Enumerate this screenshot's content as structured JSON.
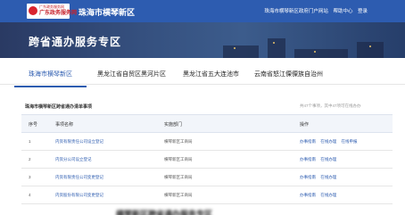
{
  "header": {
    "logo_line1": "广东政务服务网",
    "logo_line2": "广东政务服务网",
    "region": "珠海市横琴新区",
    "links": [
      "珠海市横琴新区政府门户网站",
      "帮助中心",
      "登录"
    ]
  },
  "banner": {
    "title": "跨省通办服务专区"
  },
  "tabs": [
    {
      "label": "珠海市横琴新区"
    },
    {
      "label": "黑龙江省自贸区黑河片区"
    },
    {
      "label": "黑龙江省五大连池市"
    },
    {
      "label": "云南省怒江傈僳族自治州"
    }
  ],
  "list": {
    "title": "珠海市横琴新区跨省通办清单事项",
    "count": "共47个事项，其中47项可在线办办",
    "headers": {
      "no": "序号",
      "name": "事项名称",
      "dept": "实施部门",
      "ops": "操作"
    },
    "rows": [
      {
        "no": "1",
        "name": "内资有限责任公司设立登记",
        "dept": "横琴新区工商局",
        "ops": [
          "办事指南",
          "在线办理",
          "在线申报"
        ]
      },
      {
        "no": "2",
        "name": "内资分公司设立登记",
        "dept": "横琴新区工商局",
        "ops": [
          "办事指南",
          "在线办理"
        ]
      },
      {
        "no": "3",
        "name": "内资有限责任公司变更登记",
        "dept": "横琴新区工商局",
        "ops": [
          "办事指南",
          "在线办理"
        ]
      },
      {
        "no": "4",
        "name": "内资股份有限公司变更登记",
        "dept": "横琴新区工商局",
        "ops": [
          "办事指南",
          "在线办理"
        ]
      }
    ]
  },
  "caption": "横琴新区跨省通办服务专区",
  "colors": {
    "primary": "#2d5cb0",
    "banner": "#35507f"
  }
}
